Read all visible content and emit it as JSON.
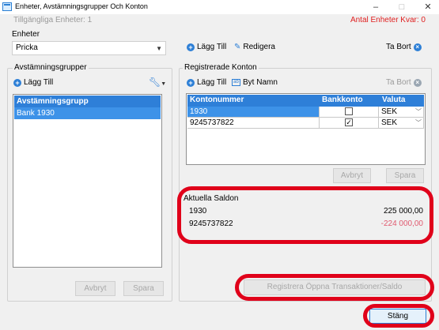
{
  "window": {
    "title": "Enheter, Avstämningsgrupper Och Konton",
    "controls": {
      "minimize": "–",
      "maximize": "□",
      "close": "✕"
    }
  },
  "info": {
    "available_units": "Tillgängliga Enheter: 1",
    "units_remaining": "Antal Enheter Kvar: 0"
  },
  "enheter": {
    "label": "Enheter",
    "selected": "Pricka",
    "add_label": "Lägg Till",
    "edit_label": "Redigera",
    "delete_label": "Ta Bort"
  },
  "avstamningsgrupper": {
    "label": "Avstämningsgrupper",
    "add_label": "Lägg Till",
    "header": "Avstämningsgrupp",
    "rows": [
      "Bank 1930"
    ],
    "cancel_label": "Avbryt",
    "save_label": "Spara"
  },
  "konton": {
    "label": "Registrerade Konton",
    "add_label": "Lägg Till",
    "rename_label": "Byt Namn",
    "delete_label": "Ta Bort",
    "columns": [
      "Kontonummer",
      "Bankkonto",
      "Valuta"
    ],
    "rows": [
      {
        "number": "1930",
        "bankkonto": false,
        "currency": "SEK"
      },
      {
        "number": "9245737822",
        "bankkonto": true,
        "currency": "SEK"
      }
    ],
    "cancel_label": "Avbryt",
    "save_label": "Spara"
  },
  "saldon": {
    "label": "Aktuella Saldon",
    "rows": [
      {
        "account": "1930",
        "amount": "225 000,00"
      },
      {
        "account": "9245737822",
        "amount": "-224 000,00"
      }
    ]
  },
  "register_label": "Registrera Öppna Transaktioner/Saldo",
  "close_label": "Stäng",
  "colors": {
    "accent": "#2e7fd8",
    "highlight": "#e0001a",
    "negative": "#e05a70"
  }
}
